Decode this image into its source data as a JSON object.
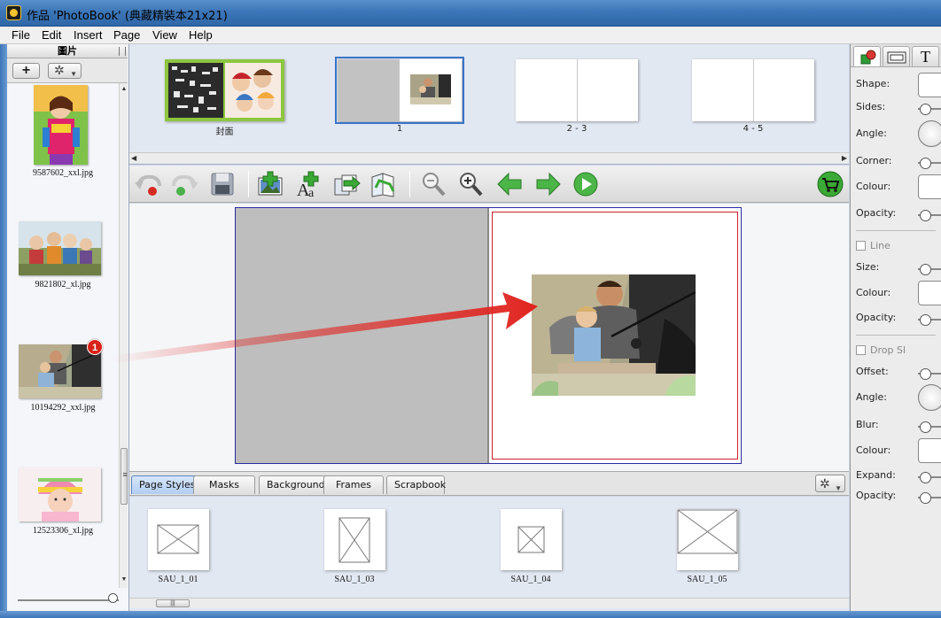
{
  "window": {
    "title": "作品 'PhotoBook' (典藏精裝本21x21)"
  },
  "menu": {
    "items": [
      "File",
      "Edit",
      "Insert",
      "Page",
      "View",
      "Help"
    ]
  },
  "left_panel": {
    "header": "圖片",
    "add_label": "+",
    "gear_label": "✲",
    "photos": [
      {
        "filename": "9587602_xxl.jpg"
      },
      {
        "filename": "9821802_xl.jpg"
      },
      {
        "filename": "10194292_xxl.jpg",
        "badge": "1"
      },
      {
        "filename": "12523306_xl.jpg"
      }
    ]
  },
  "pages_strip": {
    "pages": [
      {
        "label": "封面"
      },
      {
        "label": "1",
        "selected": true
      },
      {
        "label": "2 - 3"
      },
      {
        "label": "4 - 5"
      }
    ]
  },
  "toolbar": {
    "tools": [
      "undo-icon",
      "redo-icon",
      "save-icon",
      "add-image-icon",
      "add-text-icon",
      "add-page-icon",
      "page-layout-icon",
      "zoom-out-icon",
      "zoom-in-icon",
      "previous-page-icon",
      "next-page-icon",
      "preview-play-icon",
      "shopping-cart-icon"
    ]
  },
  "bottom_tabs": {
    "tabs": [
      "Page Styles",
      "Masks",
      "Backgrounds",
      "Frames",
      "Scrapbook"
    ],
    "active": "Page Styles",
    "gear_label": "✲"
  },
  "page_styles": {
    "items": [
      {
        "label": "SAU_1_01"
      },
      {
        "label": "SAU_1_03"
      },
      {
        "label": "SAU_1_04"
      },
      {
        "label": "SAU_1_05"
      }
    ]
  },
  "right_panel": {
    "tab_text_label": "T",
    "shape_section": {
      "shape": "Shape:",
      "sides": "Sides:",
      "angle": "Angle:",
      "corner": "Corner:",
      "colour": "Colour:",
      "opacity": "Opacity:"
    },
    "line_section": {
      "checkbox_label": "Line",
      "size": "Size:",
      "colour": "Colour:",
      "opacity": "Opacity:"
    },
    "shadow_section": {
      "checkbox_label": "Drop Sl",
      "offset": "Offset:",
      "angle": "Angle:",
      "blur": "Blur:",
      "colour": "Colour:",
      "expand": "Expand:",
      "opacity": "Opacity:"
    }
  },
  "colors": {
    "accent": "#3a74c8",
    "arrow_red": "#e0231e",
    "nav_green": "#3aa935",
    "margin_red": "#c8222a"
  }
}
